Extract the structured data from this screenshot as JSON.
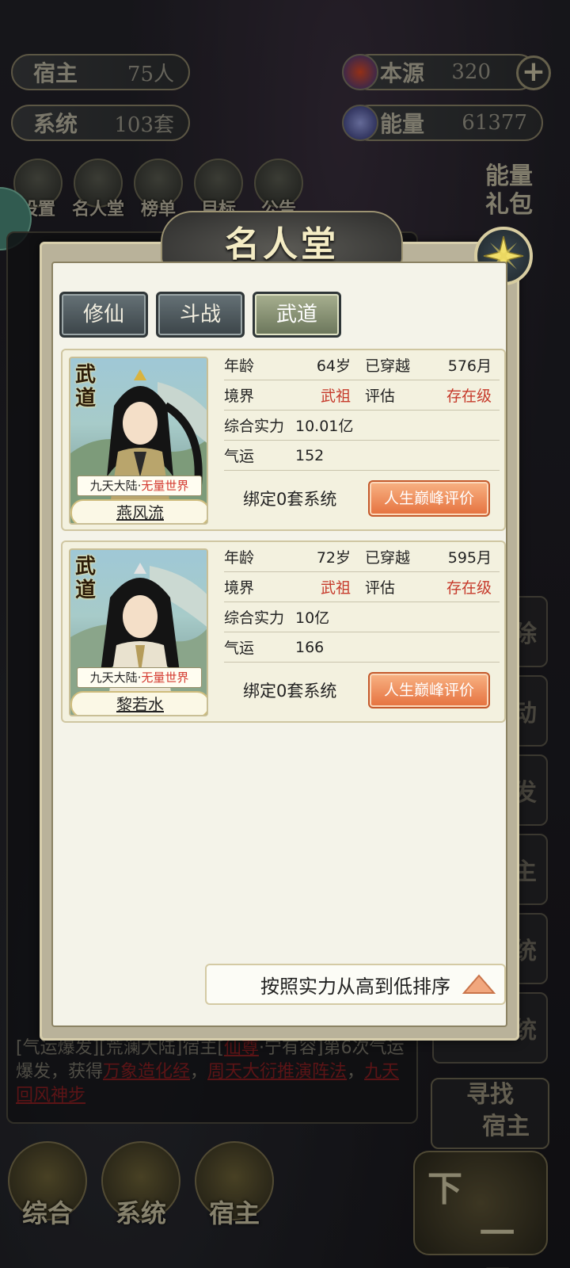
{
  "hud": {
    "host_label": "宿主",
    "host_value": "75人",
    "system_label": "系统",
    "system_value": "103套",
    "source_label": "本源",
    "source_value": "320",
    "energy_label": "能量",
    "energy_value": "61377"
  },
  "menu": {
    "items": [
      {
        "label": "设置"
      },
      {
        "label": "名人堂"
      },
      {
        "label": "榜单"
      },
      {
        "label": "目标"
      },
      {
        "label": "公告"
      }
    ],
    "gift_line1": "能量",
    "gift_line2": "礼包"
  },
  "side_buttons": [
    "除",
    "动",
    "发",
    "主",
    "统",
    "系统"
  ],
  "find_host": {
    "line1": "寻找",
    "line2": "宿主"
  },
  "log_bottom": {
    "text1": "[气运爆发][荒澜大陆]宿主[",
    "red1": "仙尊",
    "text2": "·宁有容]第6次气运爆发，获得",
    "red2": "万象造化经",
    "sep": "，",
    "red3": "周天大衍推演阵法",
    "sep2": "，",
    "red4": "九天回风神步"
  },
  "bottom_nav": [
    {
      "label": "综合"
    },
    {
      "label": "系统"
    },
    {
      "label": "宿主"
    }
  ],
  "next_month": {
    "a": "下",
    "b": "一月"
  },
  "dialog": {
    "title": "名人堂",
    "tabs": [
      {
        "label": "修仙"
      },
      {
        "label": "斗战"
      },
      {
        "label": "武道"
      }
    ],
    "active_tab": 2,
    "cards": [
      {
        "faction": "武道",
        "world_a": "九天大陆·",
        "world_b": "无量世界",
        "name": "燕风流",
        "age_label": "年龄",
        "age": "64岁",
        "travel_label": "已穿越",
        "travel": "576月",
        "realm_label": "境界",
        "realm": "武祖",
        "rating_label": "评估",
        "rating": "存在级",
        "power_label": "综合实力",
        "power": "10.01亿",
        "luck_label": "气运",
        "luck": "152",
        "bind": "绑定0套系统",
        "peak_button": "人生巅峰评价"
      },
      {
        "faction": "武道",
        "world_a": "九天大陆·",
        "world_b": "无量世界",
        "name": "黎若水",
        "age_label": "年龄",
        "age": "72岁",
        "travel_label": "已穿越",
        "travel": "595月",
        "realm_label": "境界",
        "realm": "武祖",
        "rating_label": "评估",
        "rating": "存在级",
        "power_label": "综合实力",
        "power": "10亿",
        "luck_label": "气运",
        "luck": "166",
        "bind": "绑定0套系统",
        "peak_button": "人生巅峰评价"
      }
    ],
    "sort_label": "按照实力从高到低排序"
  },
  "colors": {
    "accent_red": "#c63a2b",
    "tab_active": "#a8b090",
    "peak_button": "#e5713e"
  }
}
